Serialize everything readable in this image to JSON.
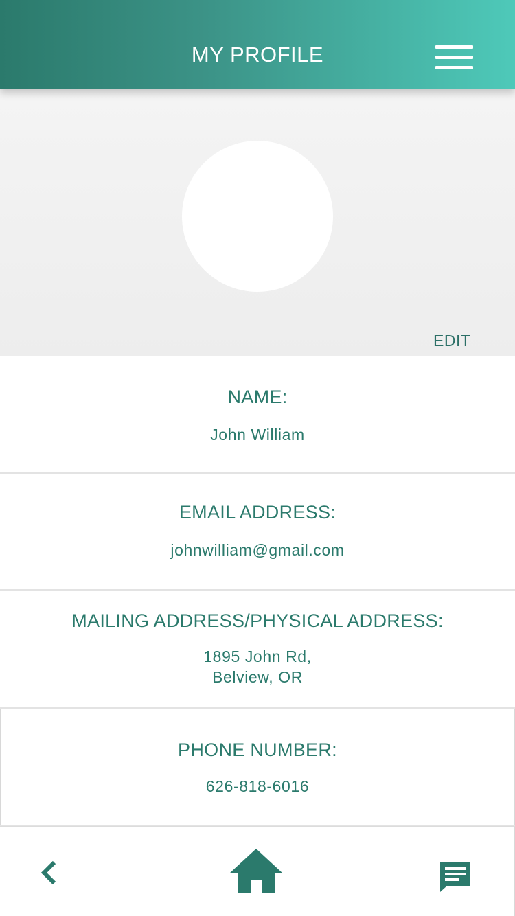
{
  "header": {
    "title": "MY PROFILE",
    "menu_icon": "hamburger-menu-icon"
  },
  "profile": {
    "avatar": "avatar-placeholder",
    "edit_label": "EDIT"
  },
  "fields": [
    {
      "label": "NAME:",
      "value": "John William"
    },
    {
      "label": "EMAIL ADDRESS:",
      "value": "johnwilliam@gmail.com"
    },
    {
      "label": "MAILING ADDRESS/PHYSICAL ADDRESS:",
      "value_lines": [
        "1895 John Rd,",
        "Belview, OR"
      ]
    },
    {
      "label": "PHONE NUMBER:",
      "value": "626-818-6016"
    }
  ],
  "bottom_nav": {
    "back_icon": "chevron-left-icon",
    "home_icon": "home-icon",
    "chat_icon": "chat-icon"
  },
  "colors": {
    "primary_dark": "#2b7a6c",
    "primary_light": "#4ec9b9",
    "profile_bg": "#efefef",
    "text_primary": "#2b7a6c"
  }
}
